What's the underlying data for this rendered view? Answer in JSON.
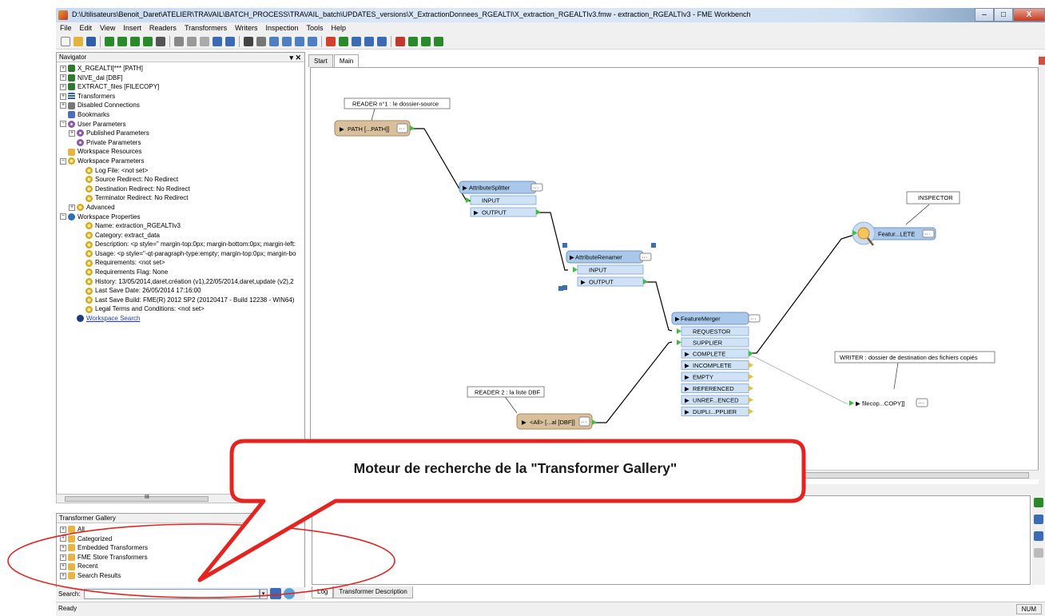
{
  "window": {
    "title": "D:\\Utilisateurs\\Benoit_Daret\\ATELIER\\TRAVAIL\\BATCH_PROCESS\\TRAVAIL_batch\\UPDATES_versions\\X_ExtractionDonnees_RGEALTI\\X_extraction_RGEALTIv3.fmw - extraction_RGEALTIv3 - FME Workbench",
    "minimize": "–",
    "maximize": "□",
    "close": "X"
  },
  "menu": [
    "File",
    "Edit",
    "View",
    "Insert",
    "Readers",
    "Transformers",
    "Writers",
    "Inspection",
    "Tools",
    "Help"
  ],
  "navigator": {
    "title": "Navigator",
    "controls": "▾ ✕",
    "items": [
      {
        "label": "X_RGEALTI[*** [PATH]",
        "icon": "reader",
        "exp": "+",
        "indent": 0
      },
      {
        "label": "NIVE_dal [DBF]",
        "icon": "reader",
        "exp": "+",
        "indent": 0
      },
      {
        "label": "EXTRACT_files [FILECOPY]",
        "icon": "reader",
        "exp": "+",
        "indent": 0
      },
      {
        "label": "Transformers",
        "icon": "lines",
        "exp": "+",
        "indent": 0
      },
      {
        "label": "Disabled Connections",
        "icon": "dc",
        "exp": "+",
        "indent": 0
      },
      {
        "label": "Bookmarks",
        "icon": "book",
        "exp": "",
        "indent": 0
      },
      {
        "label": "User Parameters",
        "icon": "gear",
        "exp": "−",
        "indent": 0
      },
      {
        "label": "Published Parameters",
        "icon": "gear",
        "exp": "+",
        "indent": 1
      },
      {
        "label": "Private Parameters",
        "icon": "gear",
        "exp": "",
        "indent": 1
      },
      {
        "label": "Workspace Resources",
        "icon": "folder",
        "exp": "",
        "indent": 0
      },
      {
        "label": "Workspace Parameters",
        "icon": "param",
        "exp": "−",
        "indent": 0
      },
      {
        "label": "Log File: <not set>",
        "icon": "param",
        "exp": "",
        "indent": 2
      },
      {
        "label": "Source Redirect: No Redirect",
        "icon": "param",
        "exp": "",
        "indent": 2
      },
      {
        "label": "Destination Redirect: No Redirect",
        "icon": "param",
        "exp": "",
        "indent": 2
      },
      {
        "label": "Terminator Redirect: No Redirect",
        "icon": "param",
        "exp": "",
        "indent": 2
      },
      {
        "label": "Advanced",
        "icon": "param",
        "exp": "+",
        "indent": 1
      },
      {
        "label": "Workspace Properties",
        "icon": "info",
        "exp": "−",
        "indent": 0
      },
      {
        "label": "Name: extraction_RGEALTIv3",
        "icon": "param",
        "exp": "",
        "indent": 2
      },
      {
        "label": "Category: extract_data",
        "icon": "param",
        "exp": "",
        "indent": 2
      },
      {
        "label": "Description: <p style=\" margin-top:0px; margin-bottom:0px; margin-left:",
        "icon": "param",
        "exp": "",
        "indent": 2
      },
      {
        "label": "Usage: <p style=\"-qt-paragraph-type:empty; margin-top:0px; margin-bo",
        "icon": "param",
        "exp": "",
        "indent": 2
      },
      {
        "label": "Requirements: <not set>",
        "icon": "param",
        "exp": "",
        "indent": 2
      },
      {
        "label": "Requirements Flag: None",
        "icon": "param",
        "exp": "",
        "indent": 2
      },
      {
        "label": "History: 13/05/2014,daret,création (v1),22/05/2014,daret,update (v2),2",
        "icon": "param",
        "exp": "",
        "indent": 2
      },
      {
        "label": "Last Save Date: 26/05/2014 17:16:00",
        "icon": "param",
        "exp": "",
        "indent": 2
      },
      {
        "label": "Last Save Build: FME(R) 2012 SP2 (20120417 - Build 12238 - WIN64)",
        "icon": "param",
        "exp": "",
        "indent": 2
      },
      {
        "label": "Legal Terms and Conditions: <not set>",
        "icon": "param",
        "exp": "",
        "indent": 2
      },
      {
        "label": "Workspace Search",
        "icon": "binoc",
        "exp": "",
        "indent": 1,
        "link": true
      }
    ],
    "scroll_label": "III"
  },
  "gallery": {
    "title": "Transformer Gallery",
    "controls": "▾ ✕",
    "items": [
      "All",
      "Categorized",
      "Embedded Transformers",
      "FME Store Transformers",
      "Recent",
      "Search Results"
    ],
    "search_label": "Search:",
    "search_value": ""
  },
  "tabs": [
    "Start",
    "Main"
  ],
  "canvas": {
    "annotations": {
      "reader1": "READER n°1 : le dossier-source",
      "inspector": "INSPECTOR",
      "writer": "WRITER : dossier de destination des fichiers copiés",
      "reader2": "READER 2 : la liste DBF"
    },
    "nodes": {
      "path_reader": "PATH [...PATH]]",
      "splitter": "AttributeSplitter",
      "splitter_in": "INPUT",
      "splitter_out": "OUTPUT",
      "renamer": "AttributeRenamer",
      "renamer_in": "INPUT",
      "renamer_out": "OUTPUT",
      "merger": "FeatureMerger",
      "merger_req": "REQUESTOR",
      "merger_sup": "SUPPLIER",
      "merger_outputs": [
        "COMPLETE",
        "INCOMPLETE",
        "EMPTY",
        "REFERENCED",
        "UNREF...ENCED",
        "DUPLI...PPLIER"
      ],
      "inspector_node": "Featur...LETE",
      "writer_node": "filecop...COPY]]",
      "dbf_reader": "<All> [...al [DBF]]",
      "more": "···"
    }
  },
  "log_tabs": [
    "Log",
    "Transformer Description"
  ],
  "status": {
    "ready": "Ready",
    "num": "NUM"
  },
  "callout": {
    "text": "Moteur de recherche de la \"Transformer Gallery\""
  },
  "colors": {
    "reader_node": "#d9c09c",
    "transformer_node": "#a9c8ea",
    "port": "#cfe2f6",
    "callout_red": "#e52420",
    "connection": "#000000"
  }
}
